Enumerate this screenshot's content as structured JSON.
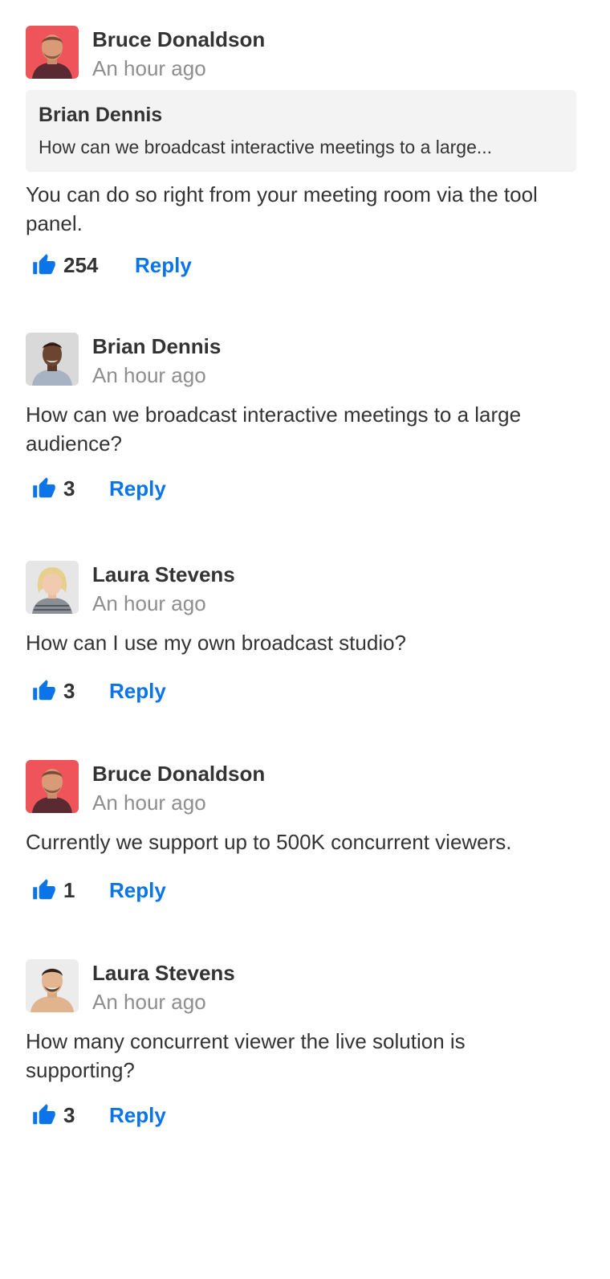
{
  "colors": {
    "accent": "#0a74e8",
    "text": "#333333",
    "muted": "#8e8e8e",
    "quote_bg": "#f3f3f3"
  },
  "comments": [
    {
      "author": "Bruce Donaldson",
      "time": "An hour ago",
      "quoted": {
        "author": "Brian Dennis",
        "text": "How can we broadcast interactive meetings to a large..."
      },
      "text": "You can do so right from your meeting room via the tool panel.",
      "likes": "254",
      "reply_label": "Reply",
      "like_icon": "thumbs-up-icon"
    },
    {
      "author": "Brian Dennis",
      "time": "An hour ago",
      "text": "How can we broadcast interactive meetings to a large audience?",
      "likes": "3",
      "reply_label": "Reply",
      "like_icon": "thumbs-up-icon"
    },
    {
      "author": "Laura Stevens",
      "time": "An hour ago",
      "text": "How can I use my own broadcast studio?",
      "likes": "3",
      "reply_label": "Reply",
      "like_icon": "thumbs-up-icon"
    },
    {
      "author": "Bruce Donaldson",
      "time": "An hour ago",
      "text": "Currently we support up to 500K concurrent viewers.",
      "likes": "1",
      "reply_label": "Reply",
      "like_icon": "thumbs-up-icon"
    },
    {
      "author": "Laura Stevens",
      "time": "An hour ago",
      "text": "How many concurrent viewer the live solution is supporting?",
      "likes": "3",
      "reply_label": "Reply",
      "like_icon": "thumbs-up-icon"
    }
  ]
}
